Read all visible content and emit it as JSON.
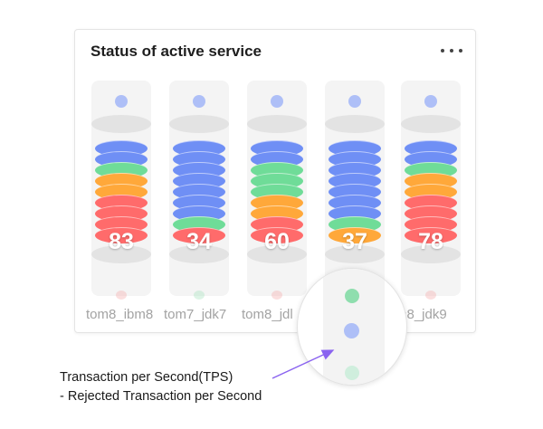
{
  "widget": {
    "title": "Status of active service",
    "more_icon": "ellipsis-icon"
  },
  "services": [
    {
      "name": "tom8_ibm8",
      "count": "83",
      "bottom_dot_color": "#f3a3a3",
      "stack": [
        "blue",
        "blue",
        "green",
        "orange",
        "orange",
        "red",
        "red",
        "red",
        "red"
      ]
    },
    {
      "name": "tom7_jdk7",
      "count": "34",
      "bottom_dot_color": "#9ee0b6",
      "stack": [
        "blue",
        "blue",
        "blue",
        "blue",
        "blue",
        "blue",
        "blue",
        "green",
        "red"
      ]
    },
    {
      "name": "tom8_jdl",
      "count": "60",
      "bottom_dot_color": "#f3a3a3",
      "stack": [
        "blue",
        "blue",
        "green",
        "green",
        "green",
        "orange",
        "orange",
        "red",
        "red"
      ]
    },
    {
      "name": "",
      "count": "37",
      "bottom_dot_color": "#aebff7",
      "stack": [
        "blue",
        "blue",
        "blue",
        "blue",
        "blue",
        "blue",
        "blue",
        "green",
        "orange"
      ]
    },
    {
      "name": "m8_jdk9",
      "count": "78",
      "bottom_dot_color": "#f3a3a3",
      "stack": [
        "blue",
        "blue",
        "green",
        "orange",
        "orange",
        "red",
        "red",
        "red",
        "red"
      ]
    }
  ],
  "colors": {
    "blue": "#6f8ff5",
    "green": "#6fdc98",
    "orange": "#ffa83a",
    "red": "#ff6b6b",
    "top_dot": "#aebff7"
  },
  "magnifier": {
    "dots": [
      "#8fdeae",
      "#aebff7",
      "#cfeedd"
    ]
  },
  "callout": {
    "line1": "Transaction per Second(TPS)",
    "line2": "- Rejected Transaction per Second"
  }
}
